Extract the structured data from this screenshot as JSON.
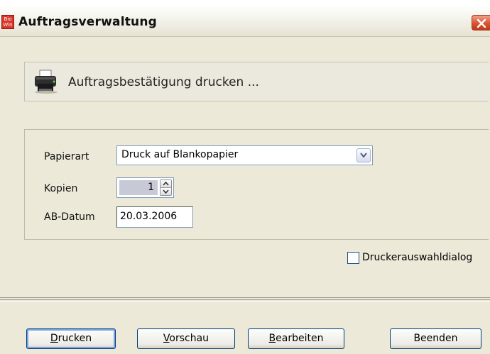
{
  "window": {
    "title": "Auftragsverwaltung",
    "app_icon_text": [
      "Bio",
      "Win"
    ],
    "accent_close": "#d9532f"
  },
  "header": {
    "text": "Auftragsbestätigung drucken ..."
  },
  "form": {
    "papierart_label": "Papierart",
    "papierart_value": "Druck auf Blankopapier",
    "kopien_label": "Kopien",
    "kopien_value": "1",
    "datum_label": "AB-Datum",
    "datum_value": "20.03.2006"
  },
  "options": {
    "druckerauswahl_label": "Druckerauswahldialog",
    "druckerauswahl_checked": false
  },
  "buttons": {
    "drucken": {
      "mnemonic": "D",
      "rest": "rucken"
    },
    "vorschau": {
      "mnemonic": "V",
      "rest": "orschau"
    },
    "bearbeiten": {
      "mnemonic": "B",
      "rest": "earbeiten"
    },
    "beenden": {
      "label": "Beenden"
    }
  }
}
